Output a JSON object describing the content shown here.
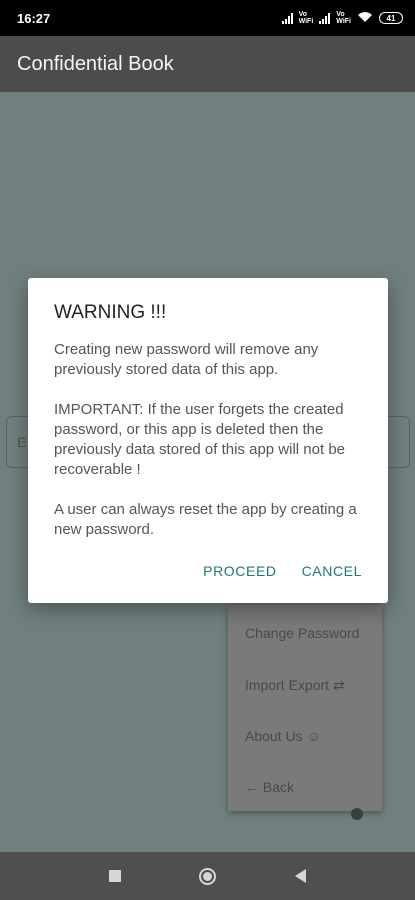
{
  "status_bar": {
    "time": "16:27",
    "network_labels": [
      "Vo",
      "WiFi"
    ],
    "battery": "41"
  },
  "app_bar": {
    "title": "Confidential Book"
  },
  "background": {
    "input_label": "E",
    "menu_items": [
      "Change Password",
      "Import Export ⇄",
      "About Us ☺",
      "← Back"
    ]
  },
  "dialog": {
    "title": "WARNING !!!",
    "paragraphs": [
      "Creating new password will remove any previously stored data of this app.",
      "IMPORTANT: If the user forgets the created password, or this app is deleted then the previously data stored of this app will not be recoverable !",
      "A user can always reset the app by creating a new password."
    ],
    "proceed_label": "PROCEED",
    "cancel_label": "CANCEL",
    "accent_color": "#1a7b70"
  },
  "nav_bar": {
    "icons": [
      "recents-square-icon",
      "home-circle-icon",
      "back-triangle-icon"
    ]
  }
}
